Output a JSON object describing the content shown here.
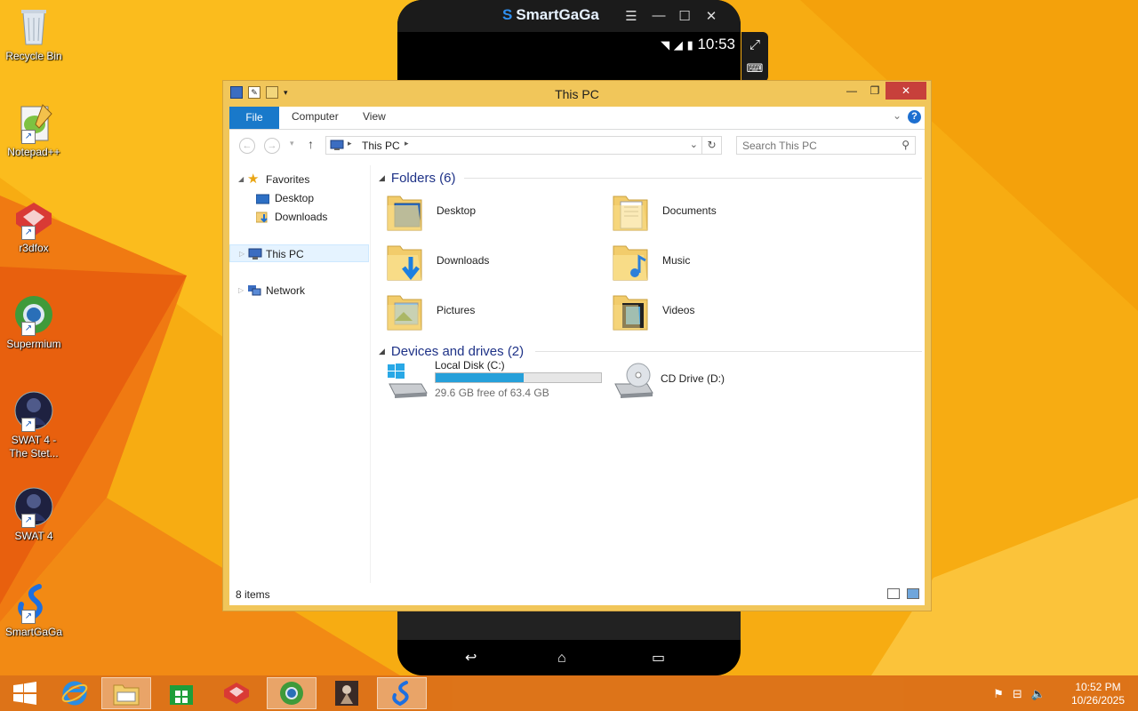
{
  "desktop": {
    "icons": [
      {
        "label": "Recycle Bin"
      },
      {
        "label": "Notepad++"
      },
      {
        "label": "r3dfox"
      },
      {
        "label": "Supermium"
      },
      {
        "label": "SWAT 4 - The Stet..."
      },
      {
        "label": "SWAT 4"
      },
      {
        "label": "SmartGaGa"
      }
    ]
  },
  "emulator": {
    "brand": "SmartGaGa",
    "time": "10:53"
  },
  "window": {
    "title": "This PC",
    "ribbon_tabs": [
      "File",
      "Computer",
      "View"
    ],
    "address_crumb": "This PC",
    "search_placeholder": "Search This PC",
    "nav": {
      "favorites": "Favorites",
      "desktop": "Desktop",
      "downloads": "Downloads",
      "this_pc": "This PC",
      "network": "Network"
    },
    "folders_header": "Folders (6)",
    "folders": [
      {
        "label": "Desktop"
      },
      {
        "label": "Documents"
      },
      {
        "label": "Downloads"
      },
      {
        "label": "Music"
      },
      {
        "label": "Pictures"
      },
      {
        "label": "Videos"
      }
    ],
    "devices_header": "Devices and drives (2)",
    "drives": {
      "c": {
        "name": "Local Disk (C:)",
        "free_text": "29.6 GB free of 63.4 GB",
        "used_fraction": 0.533
      },
      "d": {
        "name": "CD Drive (D:)"
      }
    },
    "status_count": "8 items"
  },
  "taskbar": {
    "clock_time": "10:52 PM",
    "clock_date": "10/26/2025"
  },
  "colors": {
    "wallpaper": "#f5a60d",
    "accent": "#1979ca",
    "drive_bar": "#26a0da",
    "close": "#c7403b"
  }
}
